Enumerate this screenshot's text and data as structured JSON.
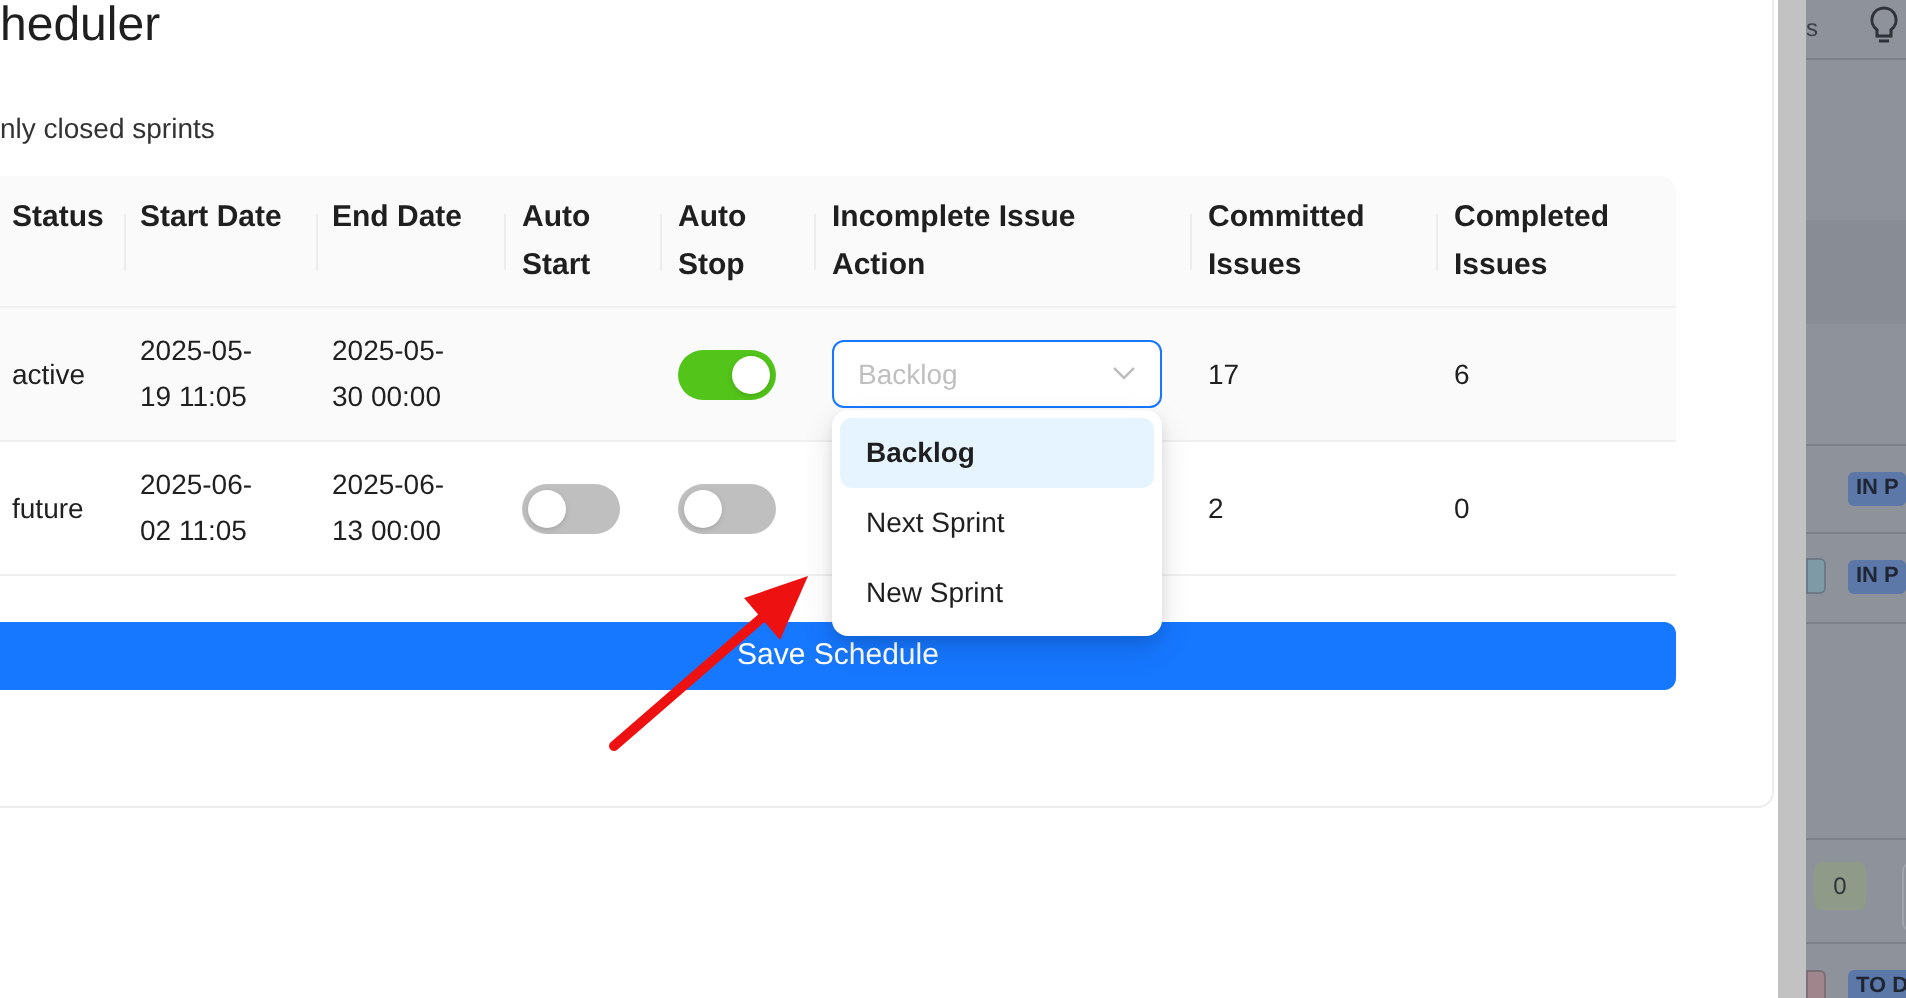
{
  "dialog": {
    "title": "heduler",
    "note": "nly closed sprints",
    "table": {
      "columns": [
        "Status",
        "Start Date",
        "End Date",
        "Auto Start",
        "Auto Stop",
        "Incomplete Issue Action",
        "Committed Issues",
        "Completed Issues"
      ],
      "rows": [
        {
          "status": "active",
          "start_date": "2025-05-19 11:05",
          "end_date": "2025-05-30 00:00",
          "auto_stop": {
            "on": true
          },
          "action": {
            "value": "Backlog",
            "open": true,
            "options": [
              {
                "label": "Backlog",
                "selected": true
              },
              {
                "label": "Next Sprint",
                "selected": false
              },
              {
                "label": "New Sprint",
                "selected": false
              }
            ]
          },
          "committed": "17",
          "completed": "6"
        },
        {
          "status": "future",
          "start_date": "2025-06-02 11:05",
          "end_date": "2025-06-13 00:00",
          "auto_start": {
            "on": false
          },
          "auto_stop": {
            "on": false
          },
          "committed": "2",
          "completed": "0"
        }
      ]
    },
    "save_button": "Save Schedule"
  },
  "background": {
    "header_text": "s",
    "badges": [
      {
        "label": "IN P"
      },
      {
        "label": "IN P"
      },
      {
        "label": "TO D"
      }
    ],
    "count": "0"
  }
}
